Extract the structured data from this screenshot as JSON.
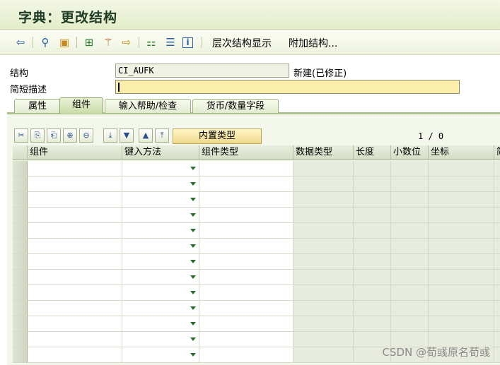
{
  "window": {
    "title": "字典：更改结构"
  },
  "toolbar": {
    "icons": [
      "back-icon",
      "glasses-icon",
      "clipboard-icon",
      "hierarchy-icon",
      "magic-wand-icon",
      "export-icon",
      "tree-icon",
      "list-icon",
      "info-icon"
    ],
    "hierarchy_label": "层次结构显示",
    "append_label": "附加结构..."
  },
  "form": {
    "structure_label": "结构",
    "structure_value": "CI_AUFK",
    "structure_status": "新建(已修正)",
    "desc_label": "简短描述",
    "desc_value": ""
  },
  "tabs": [
    "属性",
    "组件",
    "输入帮助/检查",
    "货币/数量字段"
  ],
  "table_controls": {
    "builtin_type_label": "内置类型",
    "counter": "1 / 0"
  },
  "grid": {
    "columns": [
      "组件",
      "键入方法",
      "组件类型",
      "数据类型",
      "长度",
      "小数位",
      "坐标",
      "简"
    ],
    "row_count": 13
  },
  "watermark": "CSDN @荀彧原名荀彧",
  "colors": {
    "title_bg": "#e4ecc9",
    "edit_field": "#fbeeaa",
    "tab_active": "#c8dca6"
  }
}
